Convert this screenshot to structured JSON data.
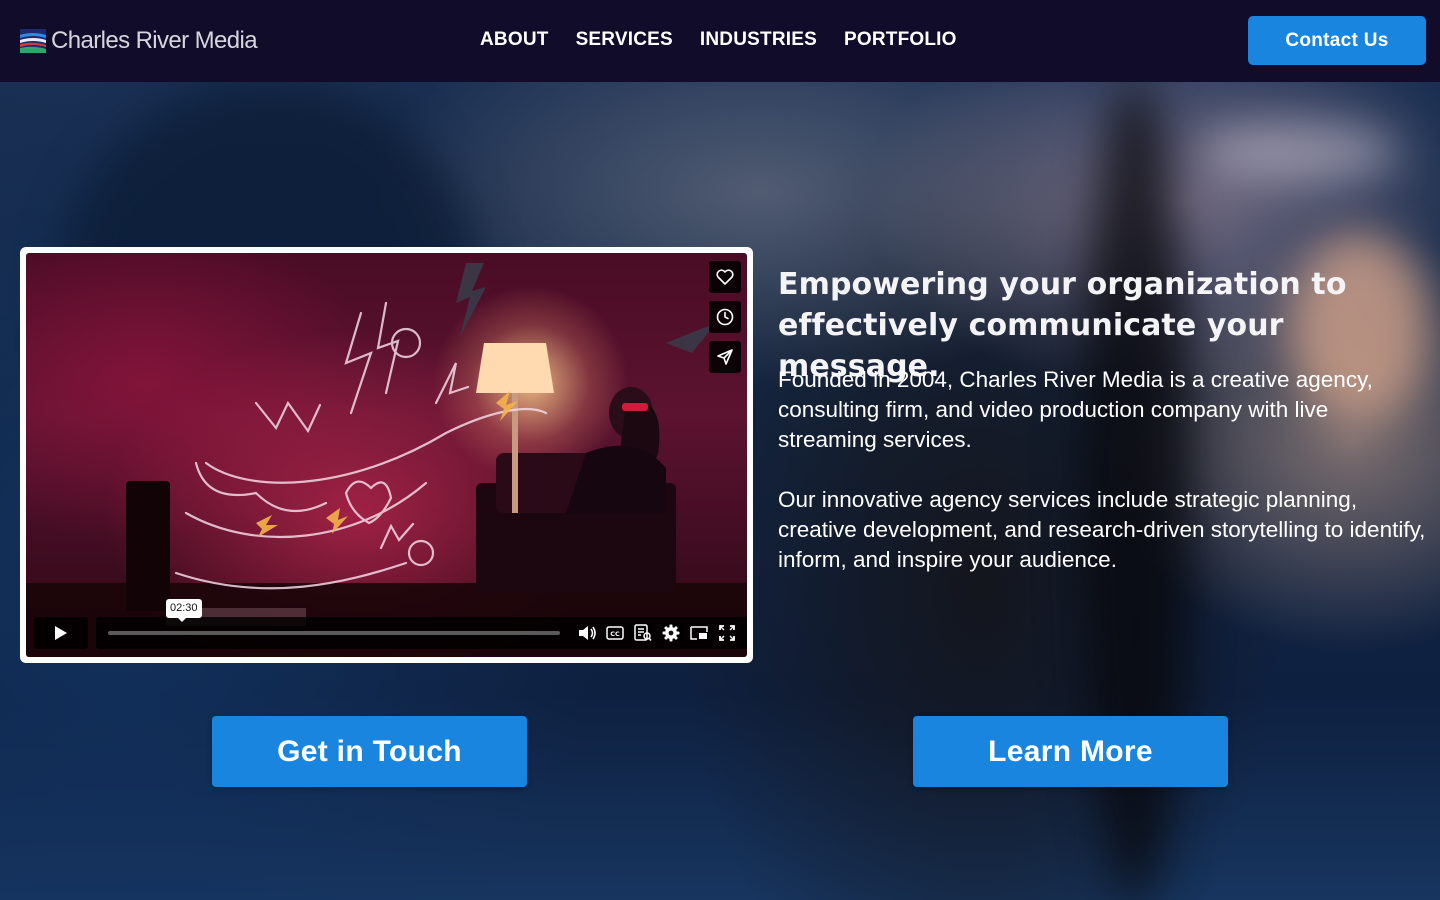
{
  "header": {
    "brand": "Charles River Media",
    "nav": [
      "ABOUT",
      "SERVICES",
      "INDUSTRIES",
      "PORTFOLIO"
    ],
    "contact_label": "Contact Us"
  },
  "video": {
    "timecode": "02:30",
    "side_icons": [
      "heart-icon",
      "clock-icon",
      "share-icon"
    ],
    "control_icons": [
      "volume-icon",
      "captions-icon",
      "transcript-icon",
      "settings-icon",
      "picture-in-picture-icon",
      "fullscreen-icon"
    ],
    "progress": 0
  },
  "hero": {
    "headline": "Empowering your organization to effectively communicate your message.",
    "paragraph_1": "Founded in 2004, Charles River Media is a creative agency, consulting firm, and video production company with live streaming services.",
    "paragraph_2": "Our innovative agency services include strategic planning, creative development, and research-driven storytelling to identify, inform, and inspire your audience."
  },
  "cta": {
    "left_label": "Get in Touch",
    "right_label": "Learn More"
  },
  "colors": {
    "header_bg": "#120c2b",
    "accent": "#1a85de",
    "text": "#ffffff"
  }
}
